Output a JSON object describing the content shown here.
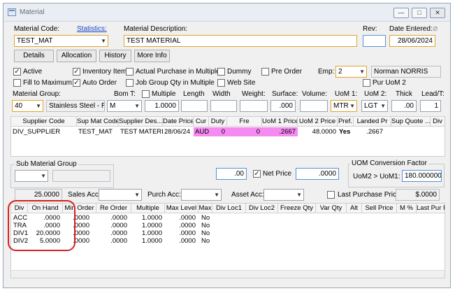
{
  "window": {
    "title": "Material",
    "minimize_glyph": "—",
    "maximize_glyph": "□",
    "close_glyph": "✕"
  },
  "header": {
    "material_code_label": "Material Code:",
    "statistics_link": "Statistics:",
    "material_code_value": "TEST_MAT",
    "description_label": "Material Description:",
    "description_value": "TEST MATERIAL",
    "rev_label": "Rev:",
    "rev_value": "",
    "date_entered_label": "Date Entered:",
    "date_entered_value": "28/06/2024"
  },
  "toolbar": {
    "details": "Details",
    "allocation": "Allocation",
    "history": "History",
    "more_info": "More Info"
  },
  "flags": {
    "active": "Active",
    "inventory_item": "Inventory Item",
    "actual_purchase_multiple": "Actual Purchase in Multiple",
    "dummy": "Dummy",
    "pre_order": "Pre Order",
    "fill_to_maximum": "Fill to Maximum",
    "auto_order": "Auto Order",
    "job_group_qty_multiple": "Job Group Qty in Multiple",
    "web_site": "Web Site",
    "pur_uom2": "Pur UoM 2",
    "check_glyph": "✓"
  },
  "employee": {
    "label": "Emp:",
    "code": "2",
    "name": "Norman NORRIS"
  },
  "material_group": {
    "label": "Material Group:",
    "code": "40",
    "name": "Stainless Steel - Rou",
    "bom_t_label": "Bom T:",
    "bom_t_value": "M",
    "multiple_label": "Multiple",
    "multiple_value": "1.0000",
    "length_label": "Length",
    "width_label": "Width",
    "weight_label": "Weight:",
    "surface_label": "Surface:",
    "surface_value": ".000",
    "volume_label": "Volume:",
    "uom1_label": "UoM 1:",
    "uom1_value": "MTR",
    "uom2_label": "UoM 2:",
    "uom2_value": "LGT",
    "thick_label": "Thick",
    "thick_value": ".00",
    "lead_label": "Lead/T:",
    "lead_value": "1"
  },
  "supplier_grid": {
    "columns": [
      "Supplier Code",
      "Sup Mat Code",
      "Supplier Des...",
      "Date Price",
      "Cur",
      "Duty",
      "Fre",
      "UoM 1 Price",
      "UoM 2 Price",
      "Pref.",
      "Landed Pr",
      "Sup Quote ...",
      "Div"
    ],
    "rows": [
      {
        "supplier_code": "DIV_SUPPLIER",
        "sup_mat_code": "TEST_MAT",
        "supplier_desc": "TEST MATERIAL",
        "date_price": "28/06/24",
        "cur": "AUD",
        "duty": "0",
        "fre": "0",
        "uom1_price": ".2667",
        "uom2_price": "48.0000",
        "pref": "Yes",
        "landed_pr": ".2667",
        "sup_quote": "",
        "div": ""
      }
    ]
  },
  "sub_group": {
    "title": "Sub Material Group",
    "code": "",
    "name": ""
  },
  "net_price": {
    "amount": ".00",
    "label": "Net Price",
    "value": ".0000"
  },
  "uom_conversion": {
    "title": "UOM Conversion Factor",
    "label": "UoM2 > UoM1:",
    "value": "180.000000"
  },
  "accounts": {
    "left_value": "25.0000",
    "sales_label": "Sales Acc:",
    "purch_label": "Purch Acc:",
    "asset_label": "Asset Acc:",
    "last_purchase_label": "Last Purchase Price",
    "last_purchase_value": "$.0000"
  },
  "stock_grid": {
    "columns": [
      "Div",
      "On Hand",
      "Min Order",
      "Re Order",
      "Multiple",
      "Max Level",
      "Max",
      "Div Loc1",
      "Div Loc2",
      "Freeze Qty",
      "Var Qty",
      "Alt",
      "Sell Price",
      "M %",
      "Last Pur F"
    ],
    "rows": [
      {
        "div": "ACC",
        "on_hand": ".0000",
        "min_order": ".0000",
        "re_order": ".0000",
        "multiple": "1.0000",
        "max_level": ".0000",
        "max": "No"
      },
      {
        "div": "TRA",
        "on_hand": ".0000",
        "min_order": ".0000",
        "re_order": ".0000",
        "multiple": "1.0000",
        "max_level": ".0000",
        "max": "No"
      },
      {
        "div": "DIV1",
        "on_hand": "20.0000",
        "min_order": ".0000",
        "re_order": ".0000",
        "multiple": "1.0000",
        "max_level": ".0000",
        "max": "No"
      },
      {
        "div": "DIV2",
        "on_hand": "5.0000",
        "min_order": ".0000",
        "re_order": ".0000",
        "multiple": "1.0000",
        "max_level": ".0000",
        "max": "No"
      }
    ]
  }
}
